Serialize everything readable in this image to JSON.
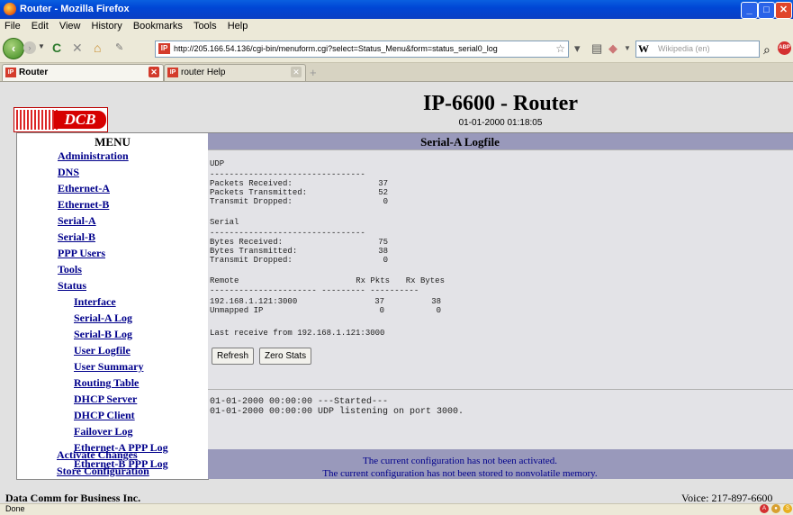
{
  "window": {
    "title": "Router - Mozilla Firefox",
    "minimize": "_",
    "maximize": "□",
    "close": "✕"
  },
  "menubar": [
    "File",
    "Edit",
    "View",
    "History",
    "Bookmarks",
    "Tools",
    "Help"
  ],
  "nav": {
    "url": "http://205.166.54.136/cgi-bin/menuform.cgi?select=Status_Menu&form=status_serial0_log",
    "search_engine_label": "W",
    "search_placeholder": "Wikipedia (en)"
  },
  "tabs": [
    {
      "label": "Router",
      "active": true
    },
    {
      "label": "router Help",
      "active": false
    }
  ],
  "header": {
    "title": "IP-6600 - Router",
    "datetime": "01-01-2000 01:18:05",
    "logo_text": "DCB"
  },
  "menu": {
    "heading": "MENU",
    "items": [
      "Administration",
      "DNS",
      "Ethernet-A",
      "Ethernet-B",
      "Serial-A",
      "Serial-B",
      "PPP Users",
      "Tools",
      "Status",
      "Interface",
      "Serial-A Log",
      "Serial-B Log",
      "User Logfile",
      "User Summary",
      "Routing Table",
      "DHCP Server",
      "DHCP Client",
      "Failover Log",
      "Ethernet-A PPP Log",
      "Ethernet-B PPP Log",
      "Activate Changes",
      "Store Configuration"
    ]
  },
  "content": {
    "heading": "Serial-A Logfile",
    "udp": {
      "title": "UDP",
      "divider": "--------------------------------",
      "rows": [
        {
          "label": "Packets Received:",
          "value": "37"
        },
        {
          "label": "Packets Transmitted:",
          "value": "52"
        },
        {
          "label": "Transmit Dropped:",
          "value": "0"
        }
      ]
    },
    "serial": {
      "title": "Serial",
      "divider": "--------------------------------",
      "rows": [
        {
          "label": "Bytes Received:",
          "value": "75"
        },
        {
          "label": "Bytes Transmitted:",
          "value": "38"
        },
        {
          "label": "Transmit Dropped:",
          "value": "0"
        }
      ]
    },
    "remote": {
      "header": [
        "Remote",
        "Rx Pkts",
        "Rx Bytes"
      ],
      "divider": "---------------------- --------- ----------",
      "rows": [
        [
          "192.168.1.121:3000",
          "37",
          "38"
        ],
        [
          "Unmapped IP",
          "0",
          "0"
        ]
      ]
    },
    "last_receive": "Last receive from 192.168.1.121:3000",
    "buttons": {
      "refresh": "Refresh",
      "zero_stats": "Zero Stats"
    },
    "events": [
      "01-01-2000 00:00:00 ---Started---",
      "01-01-2000 00:00:00 UDP listening on port 3000."
    ],
    "messages": [
      "The current configuration has not been activated.",
      "The current configuration has not been stored to nonvolatile memory."
    ]
  },
  "footer": {
    "company": "Data Comm for Business Inc.",
    "phone": "Voice: 217-897-6600"
  },
  "status": {
    "text": "Done"
  }
}
